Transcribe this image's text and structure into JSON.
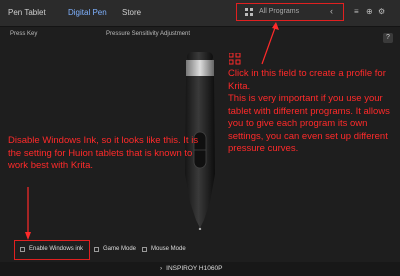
{
  "tabs": [
    {
      "label": "Pen Tablet",
      "active": false
    },
    {
      "label": "Digital Pen",
      "active": true
    },
    {
      "label": "Store",
      "active": false
    }
  ],
  "program_selector": {
    "value": "All Programs",
    "icon": "grid-icon",
    "chevron": "chevron-left-icon"
  },
  "top_icons": [
    "list-icon",
    "globe-icon",
    "settings-icon"
  ],
  "subheader": {
    "press_key": "Press Key",
    "pressure": "Pressure Sensitivity Adjustment",
    "help": "?"
  },
  "annotations": {
    "program": "Click in this field to create a profile for Krita.\nThis is very important if you use your tablet with different programs. It allows you to give each program its own settings, you can even set up different pressure curves.",
    "ink": "Disable Windows Ink, so it looks like this. It is the setting for Huion tablets that is known to work best with Krita."
  },
  "options": {
    "windows_ink": "Enable Windows ink",
    "game_mode": "Game Mode",
    "mouse_mode": "Mouse Mode"
  },
  "device": {
    "arrow": "›",
    "name": "INSPIROY H1060P"
  },
  "colors": {
    "annotation": "#ff2a2a",
    "active_tab": "#7fb2ff",
    "background": "#1e1e1e"
  }
}
